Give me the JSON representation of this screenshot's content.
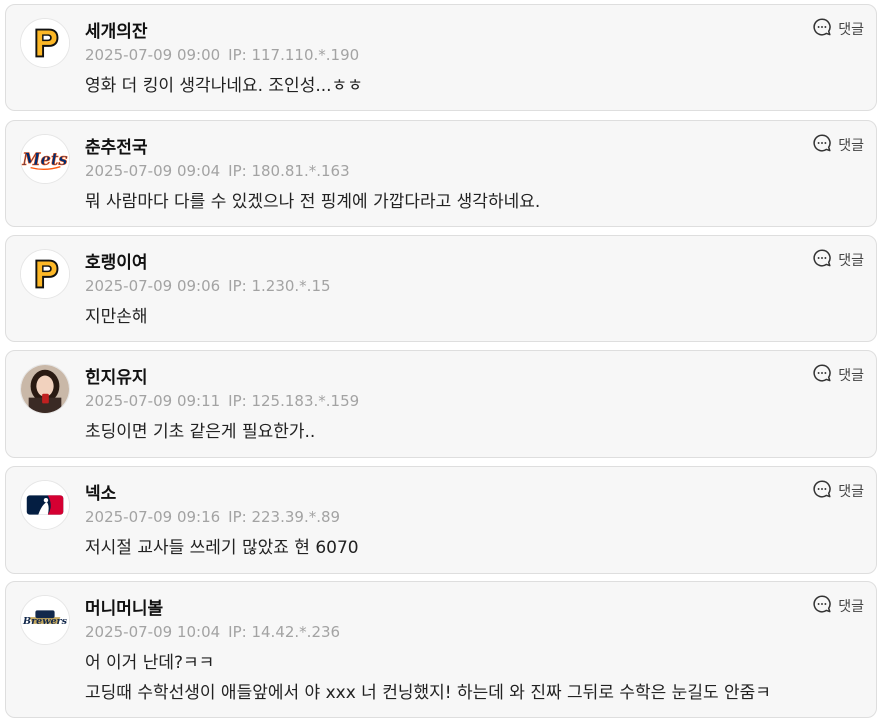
{
  "comments": [
    {
      "nickname": "세개의잔",
      "avatar": "pittsburgh-pirates-logo",
      "datetime": "2025-07-09 09:00",
      "ip": "IP: 117.110.*.190",
      "lines": [
        "영화 더 킹이 생각나네요. 조인성...ㅎㅎ"
      ],
      "reply_label": "댓글"
    },
    {
      "nickname": "춘추전국",
      "avatar": "new-york-mets-logo",
      "datetime": "2025-07-09 09:04",
      "ip": "IP: 180.81.*.163",
      "lines": [
        "뭐 사람마다 다를 수 있겠으나 전 핑계에 가깝다라고 생각하네요."
      ],
      "reply_label": "댓글"
    },
    {
      "nickname": "호랭이여",
      "avatar": "pittsburgh-pirates-logo",
      "datetime": "2025-07-09 09:06",
      "ip": "IP: 1.230.*.15",
      "lines": [
        "지만손해"
      ],
      "reply_label": "댓글"
    },
    {
      "nickname": "힌지유지",
      "avatar": "user-photo",
      "datetime": "2025-07-09 09:11",
      "ip": "IP: 125.183.*.159",
      "lines": [
        "초딩이면 기초 같은게 필요한가.."
      ],
      "reply_label": "댓글"
    },
    {
      "nickname": "넥소",
      "avatar": "mlb-logo",
      "datetime": "2025-07-09 09:16",
      "ip": "IP: 223.39.*.89",
      "lines": [
        "저시절 교사들 쓰레기 많았죠 현 6070"
      ],
      "reply_label": "댓글"
    },
    {
      "nickname": "머니머니볼",
      "avatar": "milwaukee-brewers-logo",
      "datetime": "2025-07-09 10:04",
      "ip": "IP: 14.42.*.236",
      "lines": [
        "어 이거 난데?ㅋㅋ",
        "고딩때 수학선생이 애들앞에서 야 xxx 너 컨닝했지! 하는데 와 진짜 그뒤로 수학은 눈길도 안줌ㅋ"
      ],
      "reply_label": "댓글"
    }
  ],
  "colors": {
    "card_background": "#f7f7f7",
    "card_border": "#dedede",
    "meta_text": "#a3a3a3",
    "pirates_gold": "#FDB827",
    "mets_blue": "#002D72",
    "mets_orange": "#FF5910",
    "mlb_red": "#D50032",
    "mlb_blue": "#041E42",
    "brewers_navy": "#12284B"
  }
}
